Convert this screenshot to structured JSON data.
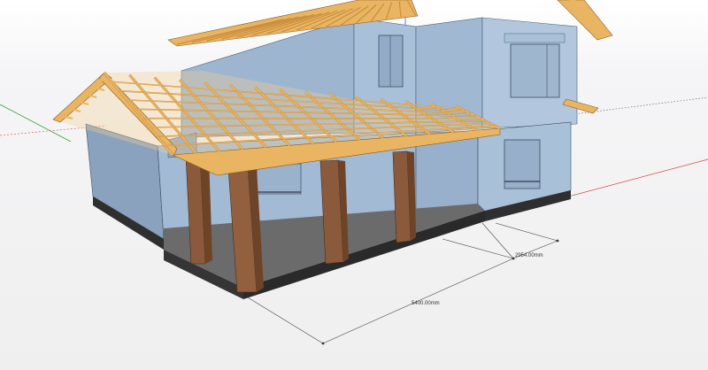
{
  "dimensions": {
    "horizontal": "5400.00mm",
    "depth": "2954.00mm"
  },
  "colors": {
    "wall_light": "#a9c0d9",
    "wall_mid": "#96aec9",
    "wall_dark": "#7f97b3",
    "timber": "#e9b563",
    "timber_dark": "#c98f3d",
    "post": "#8b5a3c",
    "post_dark": "#6e4429",
    "base": "#3a3a3a",
    "axis_red": "#d24a4a",
    "axis_green": "#37a437"
  }
}
